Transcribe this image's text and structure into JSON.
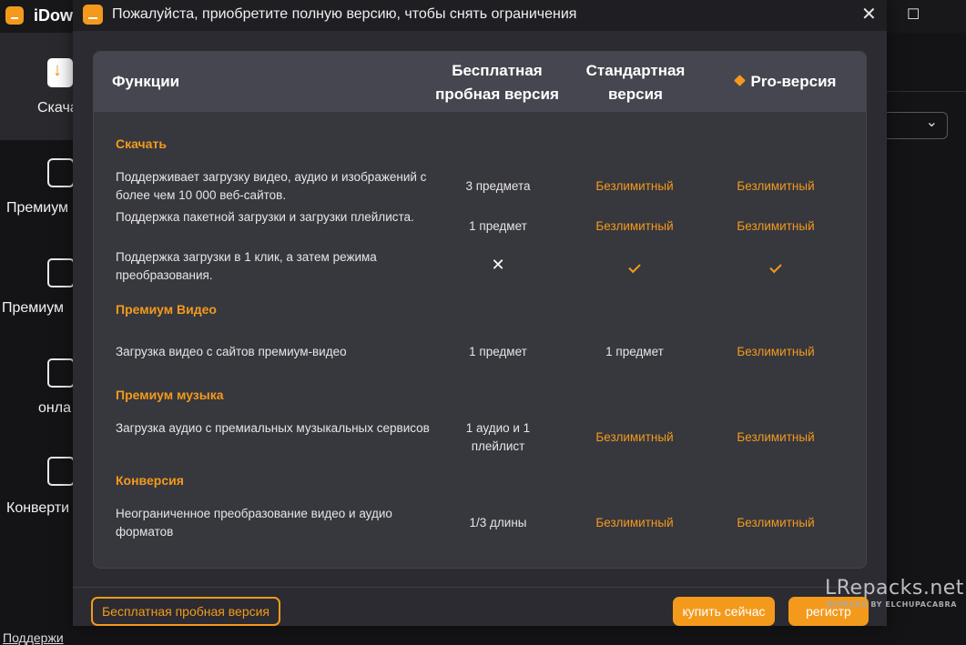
{
  "app": {
    "name": "iDow",
    "sidebar": [
      {
        "label": "Скача",
        "icon": "download-icon"
      },
      {
        "label": "Премиум",
        "icon": "play-icon"
      },
      {
        "label": "Премиум",
        "icon": "music-icon"
      },
      {
        "label": "онла",
        "icon": "globe-icon"
      },
      {
        "label": "Конверти",
        "icon": "convert-icon"
      }
    ],
    "support_link": "Поддержи",
    "window_controls": {
      "minimize": "—",
      "maximize": "☐"
    }
  },
  "dialog": {
    "title": "Пожалуйста, приобретите полную версию, чтобы снять ограничения",
    "close": "✕",
    "columns": {
      "features": "Функции",
      "free": "Бесплатная пробная версия",
      "standard": "Стандартная версия",
      "pro": "Pro-версия"
    },
    "sections": [
      {
        "title": "Скачать"
      },
      {
        "title": "Премиум Видео"
      },
      {
        "title": "Премиум музыка"
      },
      {
        "title": "Конверсия"
      }
    ],
    "rows": [
      {
        "feature": "Поддерживает загрузку видео, аудио и изображений с более чем 10 000 веб-сайтов.",
        "free": "3 предмета",
        "standard": "Безлимитный",
        "pro": "Безлимитный"
      },
      {
        "feature": "Поддержка пакетной загрузки и загрузки плейлиста.",
        "free": "1 предмет",
        "standard": "Безлимитный",
        "pro": "Безлимитный"
      },
      {
        "feature": "Поддержка загрузки в 1 клик, а затем режима преобразования.",
        "free": "✕",
        "standard": "check",
        "pro": "check"
      },
      {
        "feature": "Загрузка видео с сайтов премиум-видео",
        "free": "1 предмет",
        "standard": "1 предмет",
        "pro": "Безлимитный"
      },
      {
        "feature": "Загрузка аудио с премиальных музыкальных сервисов",
        "free": "1 аудио и 1 плейлист",
        "standard": "Безлимитный",
        "pro": "Безлимитный"
      },
      {
        "feature": "Неограниченное преобразование видео и аудио форматов",
        "free": "1/3 длины",
        "standard": "Безлимитный",
        "pro": "Безлимитный"
      }
    ],
    "buttons": {
      "trial": "Бесплатная пробная версия",
      "buy": "купить сейчас",
      "register": "регистр"
    }
  },
  "watermark": {
    "main": "LRepacks.net",
    "sub": "REPACKS BY ELCHUPACABRA"
  },
  "colors": {
    "accent": "#f39a1c",
    "dialog_bg": "#2b2b31",
    "table_bg": "#37373e",
    "header_bg": "#464650"
  }
}
